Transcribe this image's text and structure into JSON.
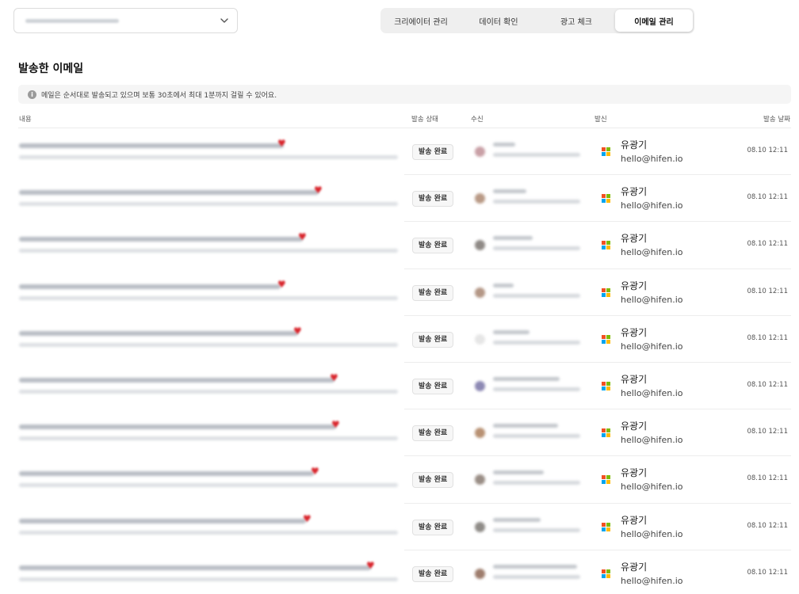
{
  "tabs": [
    {
      "label": "크리에이터 관리",
      "active": false
    },
    {
      "label": "데이터 확인",
      "active": false
    },
    {
      "label": "광고 체크",
      "active": false
    },
    {
      "label": "이메일 관리",
      "active": true
    }
  ],
  "page_title": "발송한 이메일",
  "info_text": "메일은 순서대로 발송되고 있으며 보통 30초에서 최대 1분까지 걸릴 수 있어요.",
  "columns": {
    "content": "내용",
    "status": "발송 상태",
    "to": "수신",
    "from": "발신",
    "date": "발송 날짜"
  },
  "rows": [
    {
      "status": "발송 완료",
      "sender_name": "유광기",
      "sender_email": "hello@hifen.io",
      "date": "08.10 12:11"
    },
    {
      "status": "발송 완료",
      "sender_name": "유광기",
      "sender_email": "hello@hifen.io",
      "date": "08.10 12:11"
    },
    {
      "status": "발송 완료",
      "sender_name": "유광기",
      "sender_email": "hello@hifen.io",
      "date": "08.10 12:11"
    },
    {
      "status": "발송 완료",
      "sender_name": "유광기",
      "sender_email": "hello@hifen.io",
      "date": "08.10 12:11"
    },
    {
      "status": "발송 완료",
      "sender_name": "유광기",
      "sender_email": "hello@hifen.io",
      "date": "08.10 12:11"
    },
    {
      "status": "발송 완료",
      "sender_name": "유광기",
      "sender_email": "hello@hifen.io",
      "date": "08.10 12:11"
    },
    {
      "status": "발송 완료",
      "sender_name": "유광기",
      "sender_email": "hello@hifen.io",
      "date": "08.10 12:11"
    },
    {
      "status": "발송 완료",
      "sender_name": "유광기",
      "sender_email": "hello@hifen.io",
      "date": "08.10 12:11"
    },
    {
      "status": "발송 완료",
      "sender_name": "유광기",
      "sender_email": "hello@hifen.io",
      "date": "08.10 12:11"
    },
    {
      "status": "발송 완료",
      "sender_name": "유광기",
      "sender_email": "hello@hifen.io",
      "date": "08.10 12:11"
    }
  ],
  "icons": {
    "selector": "chevron-down-icon",
    "info": "info-icon",
    "heart": "heart-icon",
    "sender_logo": "microsoft-logo-icon"
  },
  "colors": {
    "heart": "#d8232a",
    "ms_red": "#f25022",
    "ms_green": "#7fba00",
    "ms_blue": "#00a4ef",
    "ms_yellow": "#ffb900"
  }
}
